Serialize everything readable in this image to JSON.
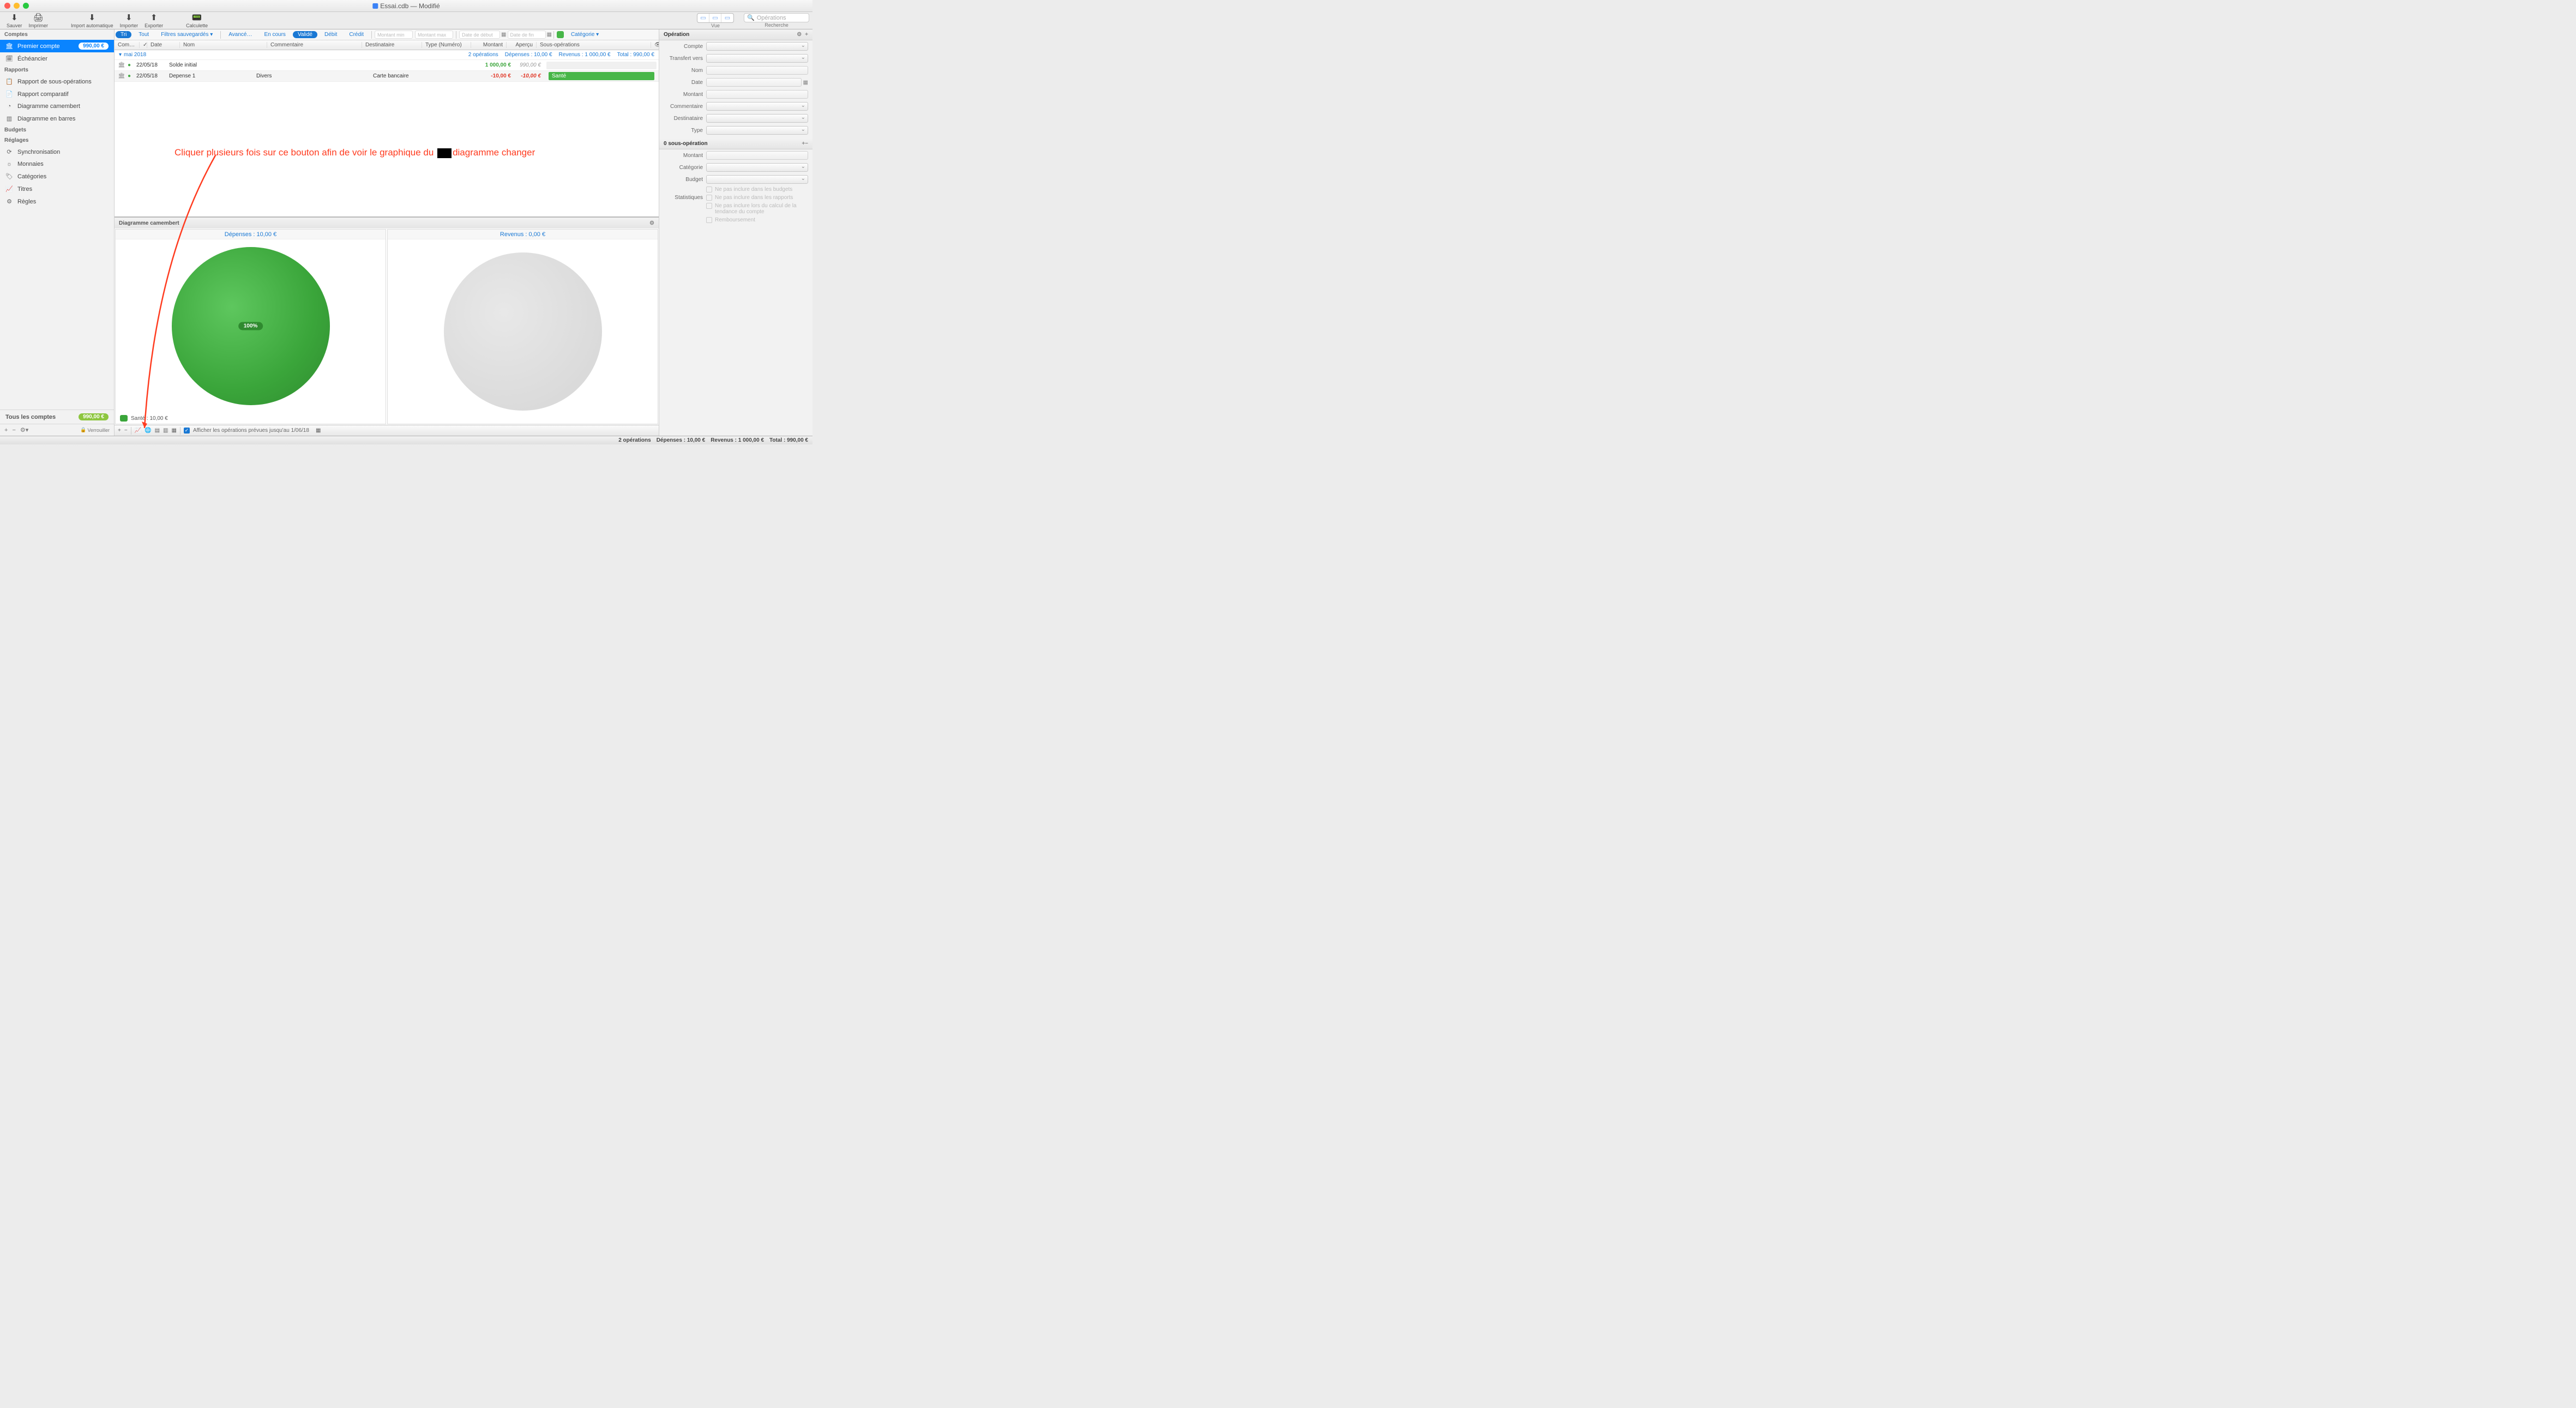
{
  "title": "Essai.cdb — Modifié",
  "toolbar": {
    "save": "Sauver",
    "print": "Imprimer",
    "autoimport": "Import automatique",
    "import": "Importer",
    "export": "Exporter",
    "calc": "Calculette",
    "vue": "Vue",
    "search_lbl": "Recherche",
    "search_ph": "Opérations"
  },
  "sidebar": {
    "sections": [
      "Comptes",
      "Rapports",
      "Budgets",
      "Réglages"
    ],
    "account": {
      "name": "Premier compte",
      "badge": "990,00 €"
    },
    "items_rapports": [
      "Échéancier",
      "Rapport de sous-opérations",
      "Rapport comparatif",
      "Diagramme camembert",
      "Diagramme en barres"
    ],
    "items_reglages": [
      "Synchronisation",
      "Monnaies",
      "Catégories",
      "Titres",
      "Règles"
    ],
    "all_accounts": "Tous les comptes",
    "all_badge": "990,00 €",
    "lock": "Verrouiller"
  },
  "filters": {
    "tri": "Tri",
    "tout": "Tout",
    "filtres": "Filtres sauvegardés",
    "avance": "Avancé…",
    "encours": "En cours",
    "valide": "Validé",
    "debit": "Débit",
    "credit": "Crédit",
    "min_ph": "Montant min",
    "max_ph": "Montant max",
    "debut_ph": "Date de début",
    "fin_ph": "Date de fin",
    "categorie": "Catégorie"
  },
  "columns": {
    "com": "Com…",
    "date": "Date",
    "nom": "Nom",
    "comm": "Commentaire",
    "dest": "Destinataire",
    "type": "Type (Numéro)",
    "mnt": "Montant",
    "ape": "Aperçu",
    "sub": "Sous-opérations"
  },
  "section": {
    "month": "mai 2018",
    "ops": "2 opérations",
    "dep": "Dépenses : 10,00 €",
    "rev": "Revenus : 1 000,00 €",
    "tot": "Total : 990,00 €"
  },
  "rows": [
    {
      "date": "22/05/18",
      "nom": "Solde initial",
      "comm": "",
      "dest": "",
      "mnt": "1 000,00 €",
      "mnt_cls": "green",
      "ape": "990,00 €",
      "cat": "",
      "catcolor": ""
    },
    {
      "date": "22/05/18",
      "nom": "Depense 1",
      "comm": "Divers",
      "dest": "Carte bancaire",
      "mnt": "-10,00 €",
      "mnt_cls": "red",
      "ape": "-10,00 €",
      "cat": "Santé",
      "catcolor": "#47b648"
    }
  ],
  "annotation": {
    "pre": "Cliquer plusieurs fois sur ce bouton afin de voir le graphique du ",
    "post": "diagramme changer"
  },
  "chart_data": [
    {
      "type": "pie",
      "title": "Dépenses : 10,00 €",
      "series": [
        {
          "name": "Santé",
          "value": 100,
          "color": "#3aa53a"
        }
      ],
      "total": "10,00 €",
      "center_label": "100%"
    },
    {
      "type": "pie",
      "title": "Revenus : 0,00 €",
      "series": [],
      "total": "0,00 €"
    }
  ],
  "chart_panel_title": "Diagramme camembert",
  "legend": {
    "label": "Santé : 10,00 €"
  },
  "bottombar": {
    "check_label": "Afficher les opérations prévues jusqu'au 1/06/18"
  },
  "inspector": {
    "title": "Opération",
    "fields": [
      "Compte",
      "Transfert vers",
      "Nom",
      "Date",
      "Montant",
      "Commentaire",
      "Destinataire",
      "Type"
    ],
    "sub_title": "0 sous-opération",
    "sub_fields": [
      "Montant",
      "Catégorie",
      "Budget"
    ],
    "stat_label": "Statistiques",
    "stat_items": [
      "Ne pas inclure dans les budgets",
      "Ne pas inclure dans les rapports",
      "Ne pas inclure lors du calcul de la tendance du compte",
      "Remboursement"
    ]
  },
  "statusbar": {
    "ops": "2 opérations",
    "dep": "Dépenses : 10,00 €",
    "rev": "Revenus : 1 000,00 €",
    "tot": "Total : 990,00 €"
  }
}
